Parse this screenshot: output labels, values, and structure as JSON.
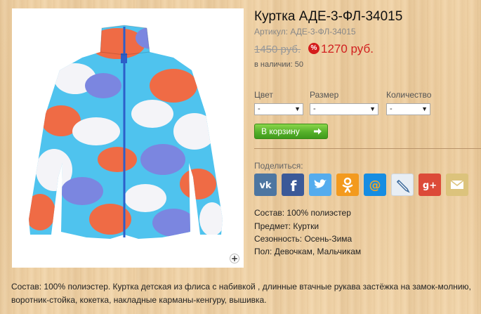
{
  "product": {
    "title": "Куртка АДЕ-3-ФЛ-34015",
    "sku": "Артикул: АДЕ-3-ФЛ-34015",
    "old_price": "1450 руб.",
    "sale_badge": "%",
    "new_price": "1270 руб.",
    "stock": "в наличии: 50"
  },
  "options": {
    "color_label": "Цвет",
    "color_value": "-",
    "size_label": "Размер",
    "size_value": "-",
    "qty_label": "Количество",
    "qty_value": "-"
  },
  "cart_button": "В корзину",
  "share": {
    "label": "Поделиться:",
    "services": [
      {
        "name": "vk",
        "icon": "vk-icon",
        "glyph": "vk",
        "color": "#4d76a1"
      },
      {
        "name": "facebook",
        "icon": "facebook-icon",
        "glyph": "f",
        "color": "#3b5998"
      },
      {
        "name": "twitter",
        "icon": "twitter-icon",
        "glyph": "bird",
        "color": "#55acee"
      },
      {
        "name": "odnoklassniki",
        "icon": "odnoklassniki-icon",
        "glyph": "ok",
        "color": "#f39a1e"
      },
      {
        "name": "mailru",
        "icon": "mailru-icon",
        "glyph": "@",
        "color": "#168de2"
      },
      {
        "name": "livejournal",
        "icon": "livejournal-icon",
        "glyph": "lj",
        "color": "#e8eef4"
      },
      {
        "name": "googleplus",
        "icon": "googleplus-icon",
        "glyph": "g+",
        "color": "#dc4a38"
      },
      {
        "name": "email",
        "icon": "email-icon",
        "glyph": "mail",
        "color": "#dcc37c"
      }
    ]
  },
  "attributes": [
    "Состав: 100% полиэстер",
    "Предмет: Куртки",
    "Сезонность: Осень-Зима",
    "Пол: Девочкам, Мальчикам"
  ],
  "description": "Состав: 100% полиэстер. Куртка детская из флиса с набивкой , длинные втачные рукава застёжка на замок-молнию, воротник-стойка, кокетка, накладные карманы-кенгуру, вышивка.",
  "zoom_glyph": "+"
}
